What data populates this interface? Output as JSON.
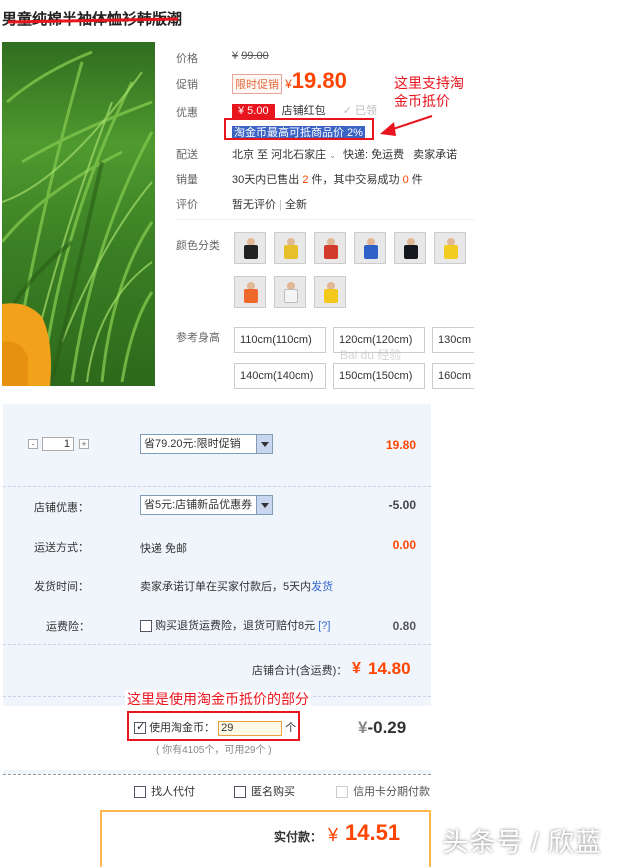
{
  "product": {
    "title": "男童纯棉半袖体恤衫韩版潮"
  },
  "props": {
    "price_label": "价格",
    "price_yen": "¥",
    "price_orig": "99.00",
    "promo_label": "促销",
    "promo_tag": "限时促销",
    "promo_yen": "¥",
    "promo_price": "19.80",
    "discount_label": "优惠",
    "coupon_amount": "¥ 5.00",
    "coupon_name": "店铺红包",
    "coupon_claimed": "✓ 已领",
    "taojinbi_text": "淘金币最高可抵商品价 2%",
    "shipping_label": "配送",
    "shipping_from": "北京 至",
    "shipping_to": "河北石家庄",
    "shipping_method": "快递: 免运费",
    "shipping_seller": "卖家承诺",
    "sales_label": "销量",
    "sales_text_1": "30天内已售出",
    "sales_count": "2",
    "sales_text_2": "件，其中交易成功",
    "sales_success": "0",
    "sales_text_3": "件",
    "review_label": "评价",
    "review_text": "暂无评价",
    "review_sep": "|",
    "review_all": "全新",
    "color_label": "颜色分类",
    "size_label": "参考身高",
    "sizes": [
      "110cm(110cm)",
      "120cm(120cm)",
      "130cm",
      "140cm(140cm)",
      "150cm(150cm)",
      "160cm"
    ]
  },
  "annotations": {
    "top_note_line1": "这里支持淘",
    "top_note_line2": "金币抵价",
    "bottom_note": "这里是使用淘金币抵价的部分"
  },
  "order": {
    "quantity": "1",
    "promo_select": "省79.20元:限时促销",
    "promo_amount": "19.80",
    "shop_discount_label": "店铺优惠：",
    "shop_discount_select": "省5元:店铺新品优惠券",
    "shop_discount_amount": "-5.00",
    "delivery_label": "运送方式：",
    "delivery_value": "快递 免邮",
    "delivery_amount": "0.00",
    "ship_time_label": "发货时间：",
    "ship_time_value": "卖家承诺订单在买家付款后，5天内",
    "ship_time_link": "发货",
    "insurance_label": "运费险：",
    "insurance_text": "购买退货运费险，退货可赔付8元",
    "insurance_help": "[?]",
    "insurance_amount": "0.80",
    "shop_total_label": "店铺合计(含运费)：",
    "shop_total_yen": "¥",
    "shop_total": "14.80",
    "taojinbi_check_label": "使用淘金币：",
    "taojinbi_value": "29",
    "taojinbi_unit": "个",
    "taojinbi_amount_yen": "¥",
    "taojinbi_amount": "-0.29",
    "taojinbi_balance": "( 你有4105个，可用29个 )",
    "opt_proxy": "找人代付",
    "opt_anonymous": "匿名购买",
    "opt_installment": "信用卡分期付款",
    "pay_label": "实付款：",
    "pay_yen": "¥",
    "pay_total": "14.51"
  },
  "watermark": "头条号 / 欣蓝",
  "baidu_watermark": "Bai du 经验",
  "colors": {
    "accent_orange": "#ff4400",
    "annotation_red": "#e8141e",
    "highlight_blue": "#3b63c4",
    "panel_bg": "#f0f4fb"
  }
}
